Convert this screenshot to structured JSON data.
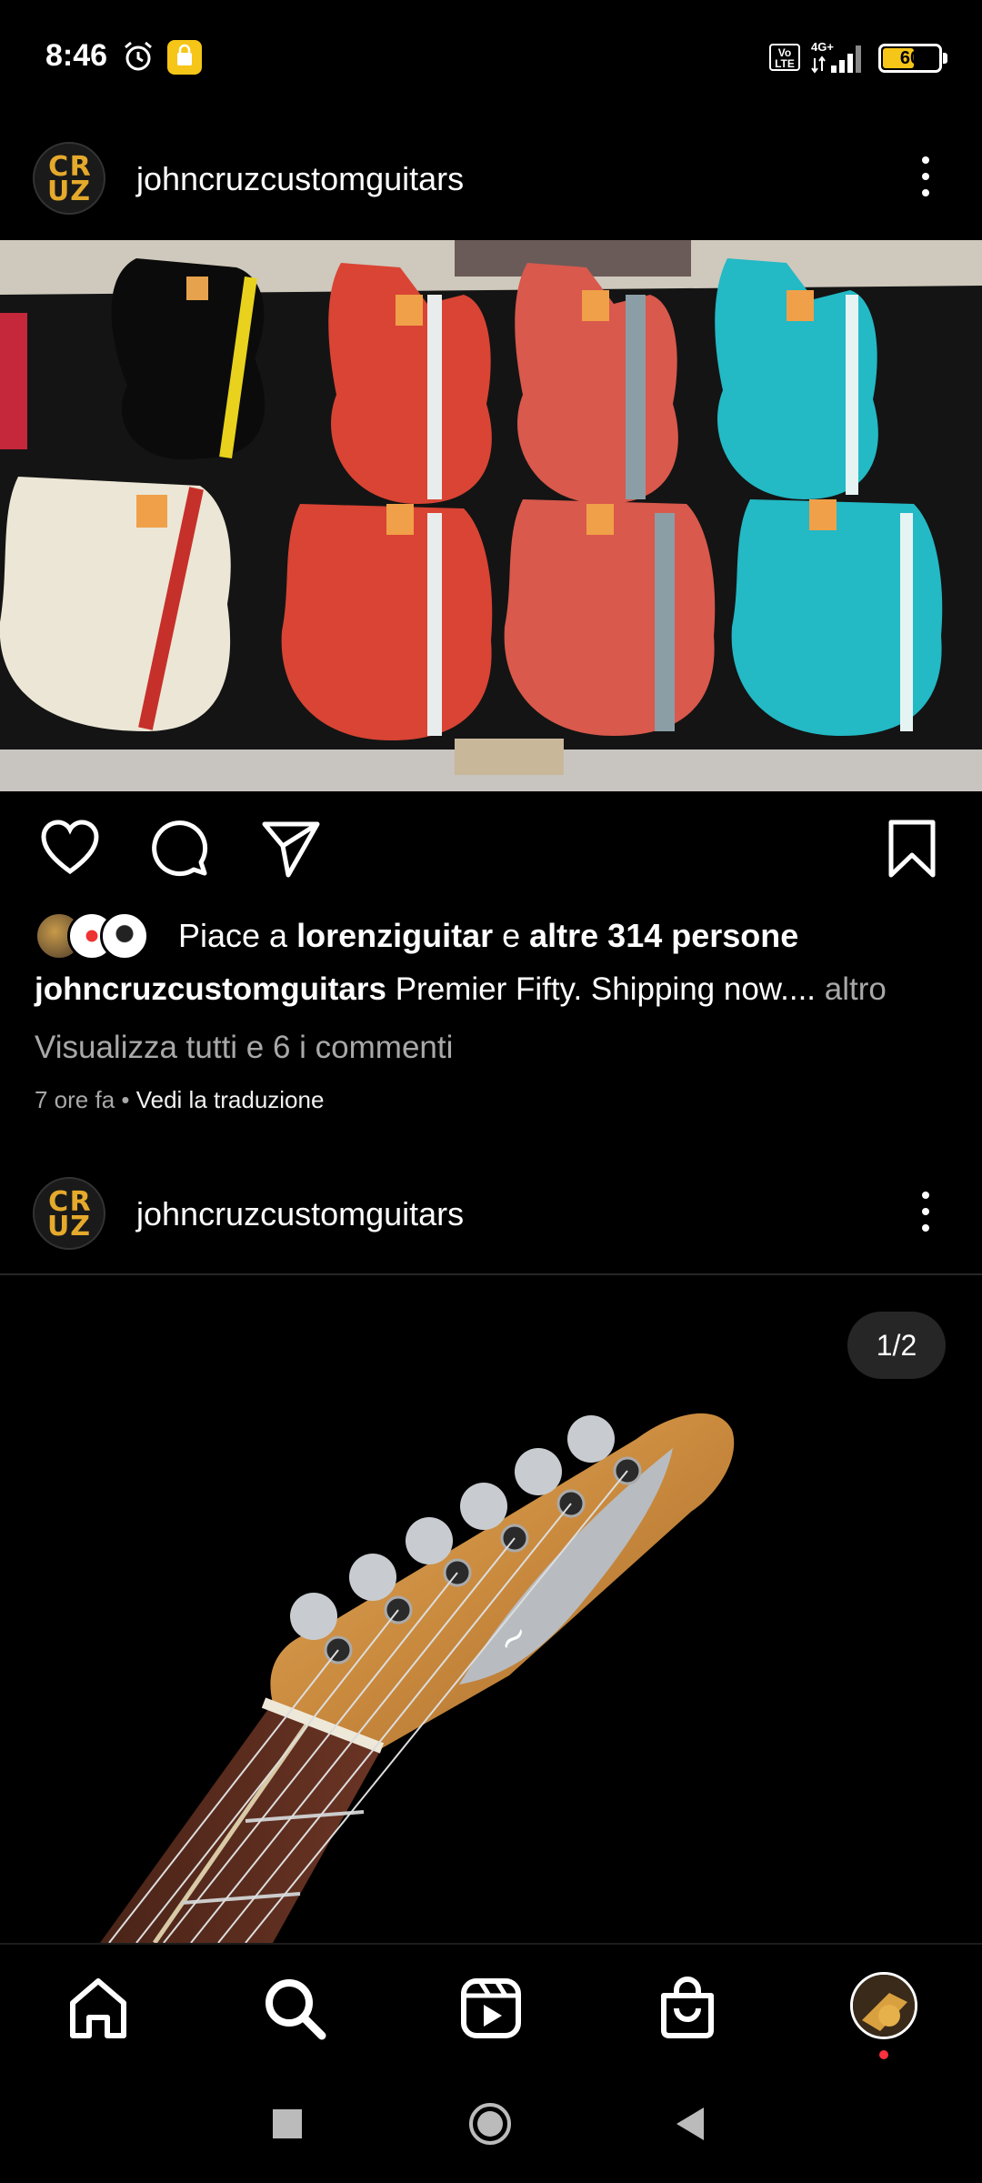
{
  "status_bar": {
    "time": "8:46",
    "network": "4G+",
    "volte": "Vo LTE",
    "battery": "60",
    "battery_level": 0.6
  },
  "posts": [
    {
      "username": "johncruzcustomguitars",
      "avatar_letters": [
        "C",
        "R",
        "U",
        "Z"
      ],
      "likes_prefix": "Piace a ",
      "liked_by": "lorenziguitar",
      "likes_conj": " e ",
      "likes_others": "altre 314 persone",
      "caption_user": "johncruzcustomguitars",
      "caption_text": " Premier Fifty. Shipping now....",
      "caption_more": " altro",
      "view_comments": "Visualizza tutti e 6 i commenti",
      "time_ago": "7 ore fa",
      "meta_separator": " • ",
      "translate": "Vedi la traduzione"
    },
    {
      "username": "johncruzcustomguitars",
      "avatar_letters": [
        "C",
        "R",
        "U",
        "Z"
      ],
      "carousel_counter": "1/2"
    }
  ],
  "icons": {
    "action_bar": [
      "heart-icon",
      "comment-icon",
      "share-icon",
      "bookmark-icon"
    ],
    "bottom_nav": [
      "home-icon",
      "search-icon",
      "reels-icon",
      "shop-icon",
      "profile-avatar"
    ],
    "system_nav": [
      "recents-icon",
      "home-circle-icon",
      "back-icon"
    ]
  },
  "colors": {
    "background": "#000000",
    "accent_gold": "#e5a92b",
    "secondary_text": "#a8a8a8",
    "notification_dot": "#ff3040",
    "battery_fill": "#f5c518"
  }
}
